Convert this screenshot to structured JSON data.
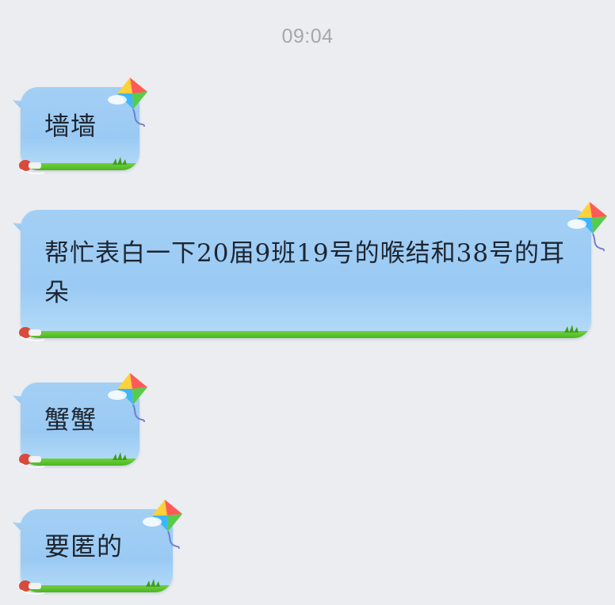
{
  "chat": {
    "timestamp": "09:04",
    "messages": [
      {
        "text": "墙墙"
      },
      {
        "text": "帮忙表白一下20届9班19号的喉结和38号的耳朵"
      },
      {
        "text": "蟹蟹"
      },
      {
        "text": "要匿的"
      }
    ]
  },
  "bubble_theme": {
    "bubble_color": "#9fcdf4",
    "grass_color": "#58bf2a",
    "background_color": "#ebedf1",
    "decoration_icons": [
      "kite-icon",
      "pushpin-icon",
      "grass-tuft-icon"
    ]
  }
}
